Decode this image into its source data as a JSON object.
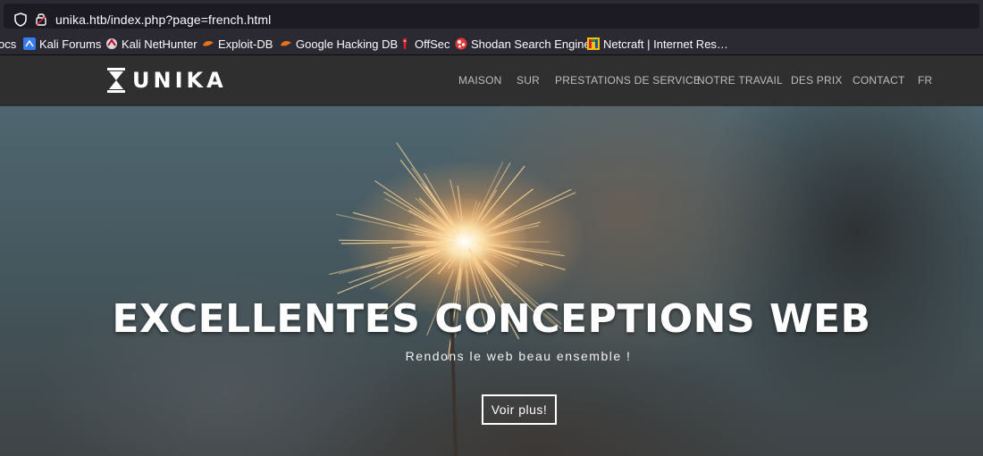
{
  "browser": {
    "url": "unika.htb/index.php?page=french.html",
    "bookmarks": [
      {
        "label": "ocs",
        "icon": "bookmark-icon"
      },
      {
        "label": "Kali Forums",
        "icon": "kali-icon"
      },
      {
        "label": "Kali NetHunter",
        "icon": "nethunter-icon"
      },
      {
        "label": "Exploit-DB",
        "icon": "exploitdb-icon"
      },
      {
        "label": "Google Hacking DB",
        "icon": "ghdb-icon"
      },
      {
        "label": "OffSec",
        "icon": "offsec-icon"
      },
      {
        "label": "Shodan Search Engine",
        "icon": "shodan-icon"
      },
      {
        "label": "Netcraft | Internet Res…",
        "icon": "netcraft-icon"
      }
    ]
  },
  "site": {
    "logo_text": "UNIKA",
    "menu": [
      "MAISON",
      "SUR",
      "PRESTATIONS DE SERVICE",
      "NOTRE TRAVAIL",
      "DES PRIX",
      "CONTACT",
      "FR"
    ]
  },
  "hero": {
    "title": "EXCELLENTES CONCEPTIONS WEB",
    "subtitle": "Rendons le web beau ensemble !",
    "button": "Voir plus!"
  },
  "colors": {
    "browser_bg": "#2b2a33",
    "nav_bg": "#2f2f2f",
    "menu_text": "#bdbdbd"
  }
}
